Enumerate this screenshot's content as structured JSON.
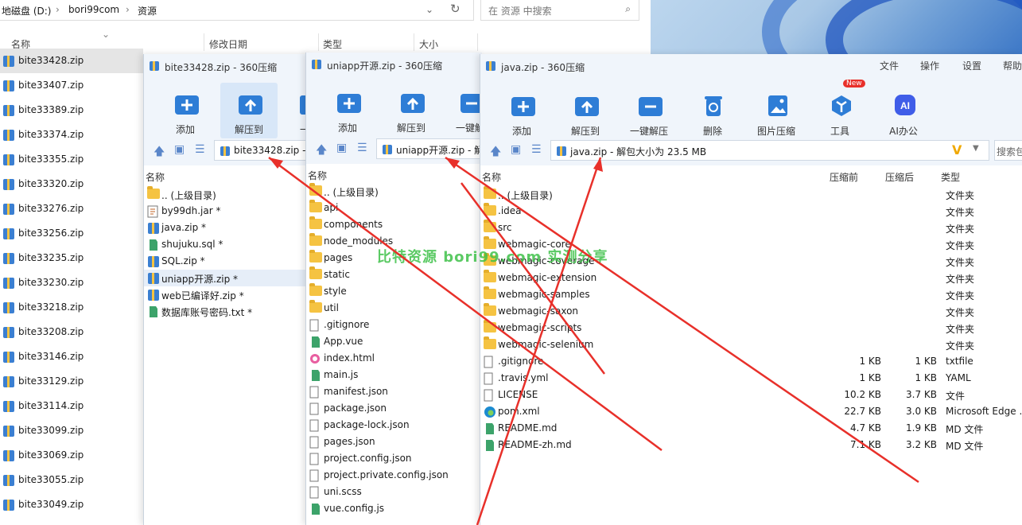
{
  "explorer": {
    "breadcrumb": [
      "地磁盘 (D:)",
      "bori99com",
      "资源"
    ],
    "search_placeholder": "在 资源 中搜索",
    "columns": [
      "名称",
      "修改日期",
      "类型",
      "大小"
    ],
    "files": [
      "bite33428.zip",
      "bite33407.zip",
      "bite33389.zip",
      "bite33374.zip",
      "bite33355.zip",
      "bite33320.zip",
      "bite33276.zip",
      "bite33256.zip",
      "bite33235.zip",
      "bite33230.zip",
      "bite33218.zip",
      "bite33208.zip",
      "bite33146.zip",
      "bite33129.zip",
      "bite33114.zip",
      "bite33099.zip",
      "bite33069.zip",
      "bite33055.zip",
      "bite33049.zip"
    ]
  },
  "win1": {
    "title": "bite33428.zip - 360压缩",
    "tools": [
      "添加",
      "解压到",
      "一键"
    ],
    "path": "bite33428.zip -",
    "list_header": "名称",
    "items": [
      {
        "name": ".. (上级目录)",
        "icon": "folder-icon"
      },
      {
        "name": "by99dh.jar *",
        "icon": "jar-icon"
      },
      {
        "name": "java.zip *",
        "icon": "zip-icon"
      },
      {
        "name": "shujuku.sql *",
        "icon": "sql-icon"
      },
      {
        "name": "SQL.zip *",
        "icon": "zip-icon"
      },
      {
        "name": "uniapp开源.zip *",
        "icon": "zip-icon"
      },
      {
        "name": "web已编译好.zip *",
        "icon": "zip-icon"
      },
      {
        "name": "数据库账号密码.txt *",
        "icon": "txt-icon"
      }
    ]
  },
  "win2": {
    "title": "uniapp开源.zip - 360压缩",
    "tools": [
      "添加",
      "解压到",
      "一键解"
    ],
    "path": "uniapp开源.zip - 解",
    "list_header": "名称",
    "items": [
      {
        "name": ".. (上级目录)",
        "icon": "folder-icon"
      },
      {
        "name": "api",
        "icon": "folder-icon"
      },
      {
        "name": "components",
        "icon": "folder-icon"
      },
      {
        "name": "node_modules",
        "icon": "folder-icon"
      },
      {
        "name": "pages",
        "icon": "folder-icon"
      },
      {
        "name": "static",
        "icon": "folder-icon"
      },
      {
        "name": "style",
        "icon": "folder-icon"
      },
      {
        "name": "util",
        "icon": "folder-icon"
      },
      {
        "name": ".gitignore",
        "icon": "file-icon"
      },
      {
        "name": "App.vue",
        "icon": "vue-icon"
      },
      {
        "name": "index.html",
        "icon": "html-icon"
      },
      {
        "name": "main.js",
        "icon": "js-icon"
      },
      {
        "name": "manifest.json",
        "icon": "file-icon"
      },
      {
        "name": "package.json",
        "icon": "file-icon"
      },
      {
        "name": "package-lock.json",
        "icon": "file-icon"
      },
      {
        "name": "pages.json",
        "icon": "file-icon"
      },
      {
        "name": "project.config.json",
        "icon": "file-icon"
      },
      {
        "name": "project.private.config.json",
        "icon": "file-icon"
      },
      {
        "name": "uni.scss",
        "icon": "file-icon"
      },
      {
        "name": "vue.config.js",
        "icon": "js-icon"
      }
    ]
  },
  "win3": {
    "title": "java.zip - 360压缩",
    "menu": [
      "文件",
      "操作",
      "设置",
      "帮助"
    ],
    "tools": [
      "添加",
      "解压到",
      "一键解压",
      "删除",
      "图片压缩",
      "工具",
      "AI办公"
    ],
    "new_badge": "New",
    "path": "java.zip - 解包大小为 23.5 MB",
    "search_placeholder": "搜索包",
    "columns": [
      "名称",
      "压缩前",
      "压缩后",
      "类型"
    ],
    "items": [
      {
        "name": ".. (上级目录)",
        "icon": "folder-icon",
        "before": "",
        "after": "",
        "type": "文件夹"
      },
      {
        "name": ".idea",
        "icon": "folder-icon",
        "before": "",
        "after": "",
        "type": "文件夹"
      },
      {
        "name": "src",
        "icon": "folder-icon",
        "before": "",
        "after": "",
        "type": "文件夹"
      },
      {
        "name": "webmagic-core",
        "icon": "folder-icon",
        "before": "",
        "after": "",
        "type": "文件夹"
      },
      {
        "name": "webmagic-coverage",
        "icon": "folder-icon",
        "before": "",
        "after": "",
        "type": "文件夹"
      },
      {
        "name": "webmagic-extension",
        "icon": "folder-icon",
        "before": "",
        "after": "",
        "type": "文件夹"
      },
      {
        "name": "webmagic-samples",
        "icon": "folder-icon",
        "before": "",
        "after": "",
        "type": "文件夹"
      },
      {
        "name": "webmagic-saxon",
        "icon": "folder-icon",
        "before": "",
        "after": "",
        "type": "文件夹"
      },
      {
        "name": "webmagic-scripts",
        "icon": "folder-icon",
        "before": "",
        "after": "",
        "type": "文件夹"
      },
      {
        "name": "webmagic-selenium",
        "icon": "folder-icon",
        "before": "",
        "after": "",
        "type": "文件夹"
      },
      {
        "name": ".gitignore",
        "icon": "file-icon",
        "before": "1 KB",
        "after": "1 KB",
        "type": "txtfile"
      },
      {
        "name": ".travis.yml",
        "icon": "file-icon",
        "before": "1 KB",
        "after": "1 KB",
        "type": "YAML"
      },
      {
        "name": "LICENSE",
        "icon": "file-icon",
        "before": "10.2 KB",
        "after": "3.7 KB",
        "type": "文件"
      },
      {
        "name": "pom.xml",
        "icon": "edge-icon",
        "before": "22.7 KB",
        "after": "3.0 KB",
        "type": "Microsoft Edge ."
      },
      {
        "name": "README.md",
        "icon": "md-icon",
        "before": "4.7 KB",
        "after": "1.9 KB",
        "type": "MD 文件"
      },
      {
        "name": "README-zh.md",
        "icon": "md-icon",
        "before": "7.1 KB",
        "after": "3.2 KB",
        "type": "MD 文件"
      }
    ]
  },
  "watermark": "比特资源  bori99.com  实测分享",
  "colors": {
    "arrow": "#e8302a",
    "accent": "#2e7dd6",
    "watermark": "#3fc14a"
  }
}
